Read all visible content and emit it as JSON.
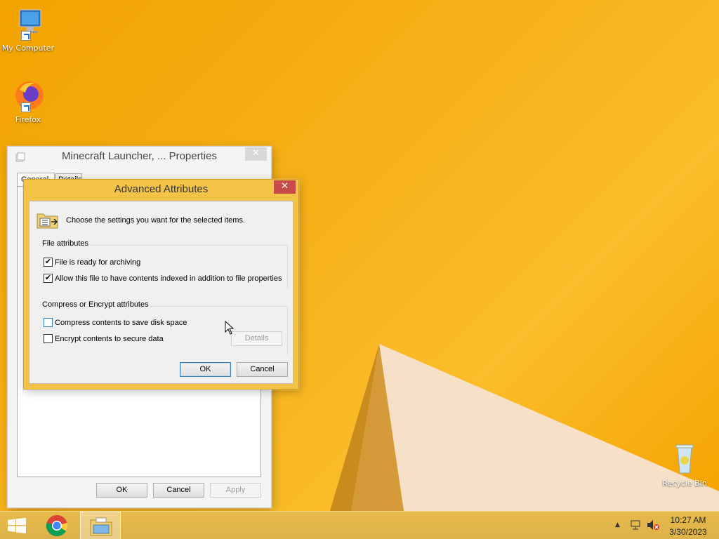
{
  "desktop": {
    "icons": [
      {
        "label": "My Computer",
        "icon": "computer-icon"
      },
      {
        "label": "Firefox",
        "icon": "firefox-icon"
      },
      {
        "label": "Recycle Bin",
        "icon": "recycle-bin-icon"
      }
    ]
  },
  "properties_window": {
    "title": "Minecraft Launcher, ... Properties",
    "tabs": [
      "General",
      "Details"
    ],
    "buttons": {
      "ok": "OK",
      "cancel": "Cancel",
      "apply": "Apply"
    }
  },
  "advanced_dialog": {
    "title": "Advanced Attributes",
    "intro": "Choose the settings you want for the selected items.",
    "file_attributes": {
      "label": "File attributes",
      "archive": {
        "label": "File is ready for archiving",
        "checked": true
      },
      "index": {
        "label": "Allow this file to have contents indexed in addition to file properties",
        "checked": true
      }
    },
    "compress_encrypt": {
      "label": "Compress or Encrypt attributes",
      "compress": {
        "label": "Compress contents to save disk space",
        "checked": false
      },
      "encrypt": {
        "label": "Encrypt contents to secure data",
        "checked": false
      },
      "details_label": "Details"
    },
    "buttons": {
      "ok": "OK",
      "cancel": "Cancel"
    }
  },
  "taskbar": {
    "apps": [
      "start-icon",
      "chrome-icon",
      "file-explorer-icon"
    ],
    "tray": {
      "time": "10:27 AM",
      "date": "3/30/2023"
    }
  },
  "colors": {
    "accent": "#f2c347",
    "close_active": "#c94a4a",
    "desktop": "#f6a800"
  }
}
